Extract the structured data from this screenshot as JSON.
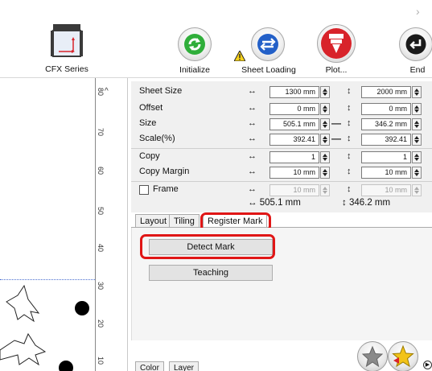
{
  "toolbar": {
    "machine_label": "CFX Series",
    "initialize_label": "Initialize",
    "sheet_loading_label": "Sheet Loading",
    "plot_label": "Plot...",
    "end_label": "End"
  },
  "ruler": {
    "ticks": [
      "80",
      "70",
      "60",
      "50",
      "40",
      "30",
      "20",
      "10"
    ]
  },
  "settings": {
    "rows": [
      {
        "label": "Sheet Size",
        "h_value": "1300 mm",
        "v_value": "2000 mm"
      },
      {
        "label": "Offset",
        "h_value": "0 mm",
        "v_value": "0 mm"
      },
      {
        "label": "Size",
        "h_value": "505.1 mm",
        "v_value": "346.2 mm"
      },
      {
        "label": "Scale(%)",
        "h_value": "392.41",
        "v_value": "392.41"
      },
      {
        "label": "Copy",
        "h_value": "1",
        "v_value": "1"
      },
      {
        "label": "Copy Margin",
        "h_value": "10 mm",
        "v_value": "10 mm"
      },
      {
        "label": "Frame",
        "h_value": "10 mm",
        "v_value": "10 mm"
      }
    ],
    "width_summary": "↔ 505.1 mm",
    "height_summary": "↕ 346.2 mm"
  },
  "tabs": {
    "items": [
      "Layout",
      "Tiling",
      "Register Mark"
    ],
    "active": "Register Mark"
  },
  "register_mark": {
    "detect_label": "Detect Mark",
    "teaching_label": "Teaching"
  },
  "bottom_tabs": [
    "Color",
    "Layer"
  ],
  "colors": {
    "highlight": "#e01616",
    "green": "#2fae3a",
    "blue": "#2360c8",
    "red": "#d8232a",
    "yellow": "#f2c318"
  }
}
